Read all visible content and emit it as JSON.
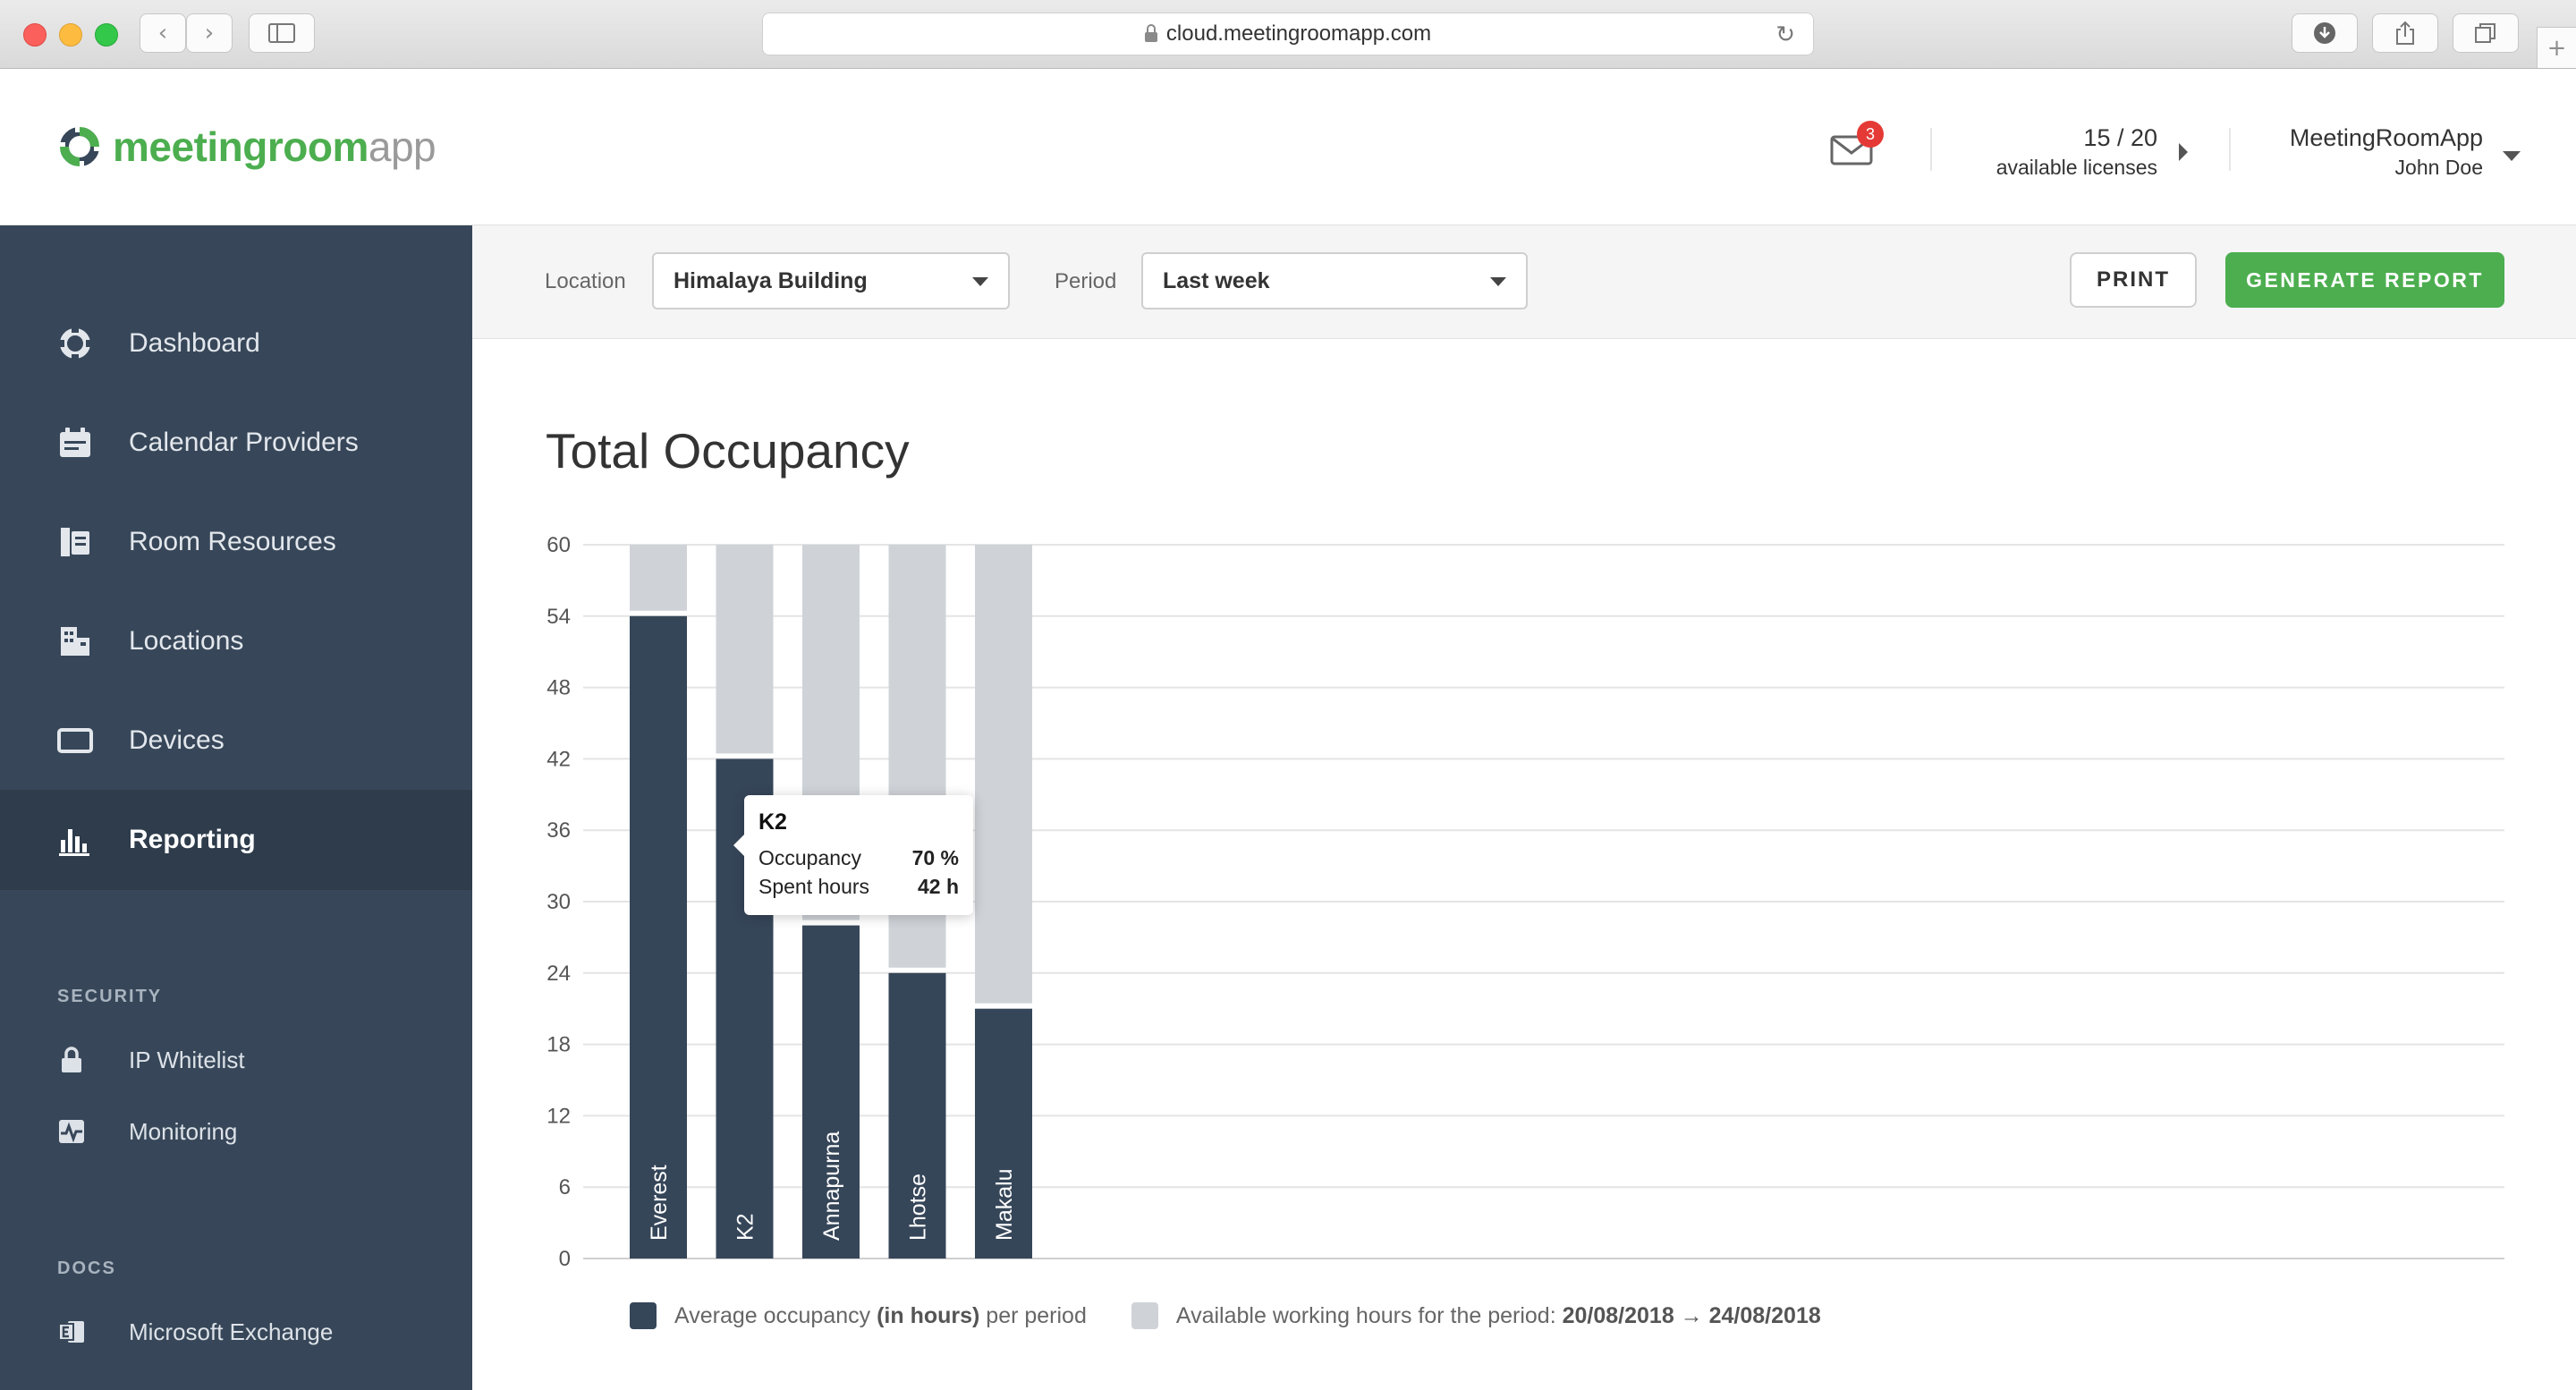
{
  "browser": {
    "url": "cloud.meetingroomapp.com"
  },
  "header": {
    "logo": {
      "part1": "meetingroom",
      "part2": "app"
    },
    "mail_badge": "3",
    "licenses": {
      "count": "15 / 20",
      "label": "available licenses"
    },
    "user": {
      "org": "MeetingRoomApp",
      "name": "John Doe"
    }
  },
  "sidebar": {
    "items": [
      {
        "label": "Dashboard",
        "icon": "dashboard-icon"
      },
      {
        "label": "Calendar Providers",
        "icon": "calendar-icon"
      },
      {
        "label": "Room Resources",
        "icon": "room-resources-icon"
      },
      {
        "label": "Locations",
        "icon": "building-icon"
      },
      {
        "label": "Devices",
        "icon": "tablet-icon"
      },
      {
        "label": "Reporting",
        "icon": "bar-chart-icon",
        "active": true
      }
    ],
    "security": {
      "title": "SECURITY",
      "items": [
        {
          "label": "IP Whitelist",
          "icon": "lock-icon"
        },
        {
          "label": "Monitoring",
          "icon": "monitoring-icon"
        }
      ]
    },
    "docs": {
      "title": "DOCS",
      "items": [
        {
          "label": "Microsoft Exchange",
          "icon": "exchange-icon"
        }
      ]
    }
  },
  "filters": {
    "location_label": "Location",
    "location_value": "Himalaya Building",
    "period_label": "Period",
    "period_value": "Last week",
    "print_label": "PRINT",
    "generate_label": "GENERATE REPORT"
  },
  "report": {
    "title": "Total Occupancy",
    "tooltip": {
      "title": "K2",
      "rows": [
        {
          "label": "Occupancy",
          "value": "70 %"
        },
        {
          "label": "Spent hours",
          "value": "42 h"
        }
      ]
    },
    "legend": {
      "occupied_pre": "Average occupancy ",
      "occupied_bold": "(in hours)",
      "occupied_post": " per period",
      "available_pre": "Available working hours for the period: ",
      "available_bold": "20/08/2018 → 24/08/2018"
    }
  },
  "colors": {
    "brand_green": "#4cae4f",
    "sidebar": "#374759",
    "occupied": "#364659",
    "available": "#cfd3d8"
  },
  "chart_data": {
    "type": "bar",
    "stacked": true,
    "categories": [
      "Everest",
      "K2",
      "Annapurna",
      "Lhotse",
      "Makalu"
    ],
    "series": [
      {
        "name": "Average occupancy (in hours) per period",
        "values": [
          54,
          42,
          28,
          24,
          21
        ]
      },
      {
        "name": "Available working hours for the period",
        "values": [
          60,
          60,
          60,
          60,
          60
        ]
      }
    ],
    "yticks": [
      0,
      6,
      12,
      18,
      24,
      30,
      36,
      42,
      48,
      54,
      60
    ],
    "ylim": [
      0,
      60
    ],
    "grid": true,
    "legend_position": "bottom-left"
  }
}
